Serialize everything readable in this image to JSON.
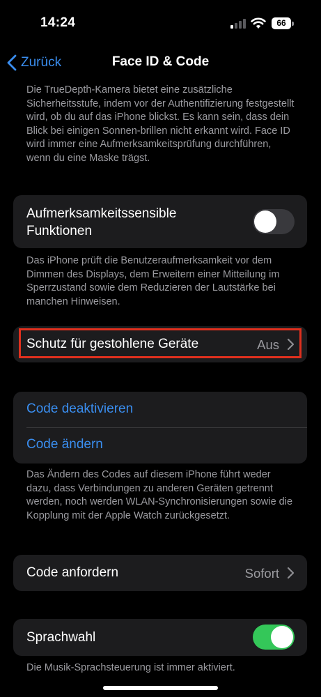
{
  "status_bar": {
    "time": "14:24",
    "battery_level": "66",
    "signal_icon": "cellular-signal-icon",
    "wifi_icon": "wifi-icon"
  },
  "nav": {
    "back_label": "Zurück",
    "title": "Face ID & Code"
  },
  "sections": {
    "attention_intro_footnote": "Die TrueDepth-Kamera bietet eine zusätzliche Sicherheitsstufe, indem vor der Authentifizierung festgestellt wird, ob du auf das iPhone blickst. Es kann sein, dass dein Blick bei einigen Sonnen-brillen nicht erkannt wird. Face ID wird immer eine Aufmerksamkeitsprüfung durchführen, wenn du eine Maske trägst.",
    "attention_aware": {
      "label": "Aufmerksamkeitssensible Funktionen",
      "enabled": false
    },
    "attention_aware_footnote": "Das iPhone prüft die Benutzeraufmerksamkeit vor dem Dimmen des Displays, dem Erweitern einer Mitteilung im Sperrzustand sowie dem Reduzieren der Lautstärke bei manchen Hinweisen.",
    "stolen_device": {
      "label": "Schutz für gestohlene Geräte",
      "value": "Aus"
    },
    "code_actions": {
      "deactivate": "Code deaktivieren",
      "change": "Code ändern"
    },
    "code_footnote": "Das Ändern des Codes auf diesem iPhone führt weder dazu, dass Verbindungen zu anderen Geräten getrennt werden, noch werden WLAN-Synchronisierungen sowie die Kopplung mit der Apple Watch zurückgesetzt.",
    "require_code": {
      "label": "Code anfordern",
      "value": "Sofort"
    },
    "voice_dial": {
      "label": "Sprachwahl",
      "enabled": true
    },
    "voice_dial_footnote": "Die Musik-Sprachsteuerung ist immer aktiviert."
  },
  "colors": {
    "accent": "#3a8ef0",
    "toggle_on": "#34c759",
    "highlight": "#e0301e"
  }
}
